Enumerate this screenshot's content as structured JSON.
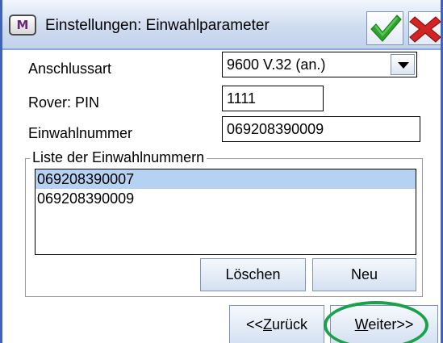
{
  "window": {
    "app_icon_letter": "M",
    "title": "Einstellungen: Einwahlparameter",
    "ok_icon": "checkmark-icon",
    "cancel_icon": "close-icon",
    "colors": {
      "title_gradient_top": "#f3f7fd",
      "title_gradient_bottom": "#c2d2ec",
      "frame_border": "#3f63b6",
      "ok_green": "#2aa52a",
      "cancel_red": "#d42323",
      "selected_row": "#b6d2f2",
      "highlight_ring": "#1aa24a"
    }
  },
  "form": {
    "connection_type_label": "Anschlussart",
    "connection_type_value": "9600 V.32 (an.)",
    "rover_pin_label": "Rover: PIN",
    "rover_pin_value": "1111",
    "dial_number_label": "Einwahlnummer",
    "dial_number_value": "069208390009"
  },
  "dial_list": {
    "group_title": "Liste der Einwahlnummern",
    "items": [
      "069208390007",
      "069208390009"
    ],
    "selected_index": 0,
    "delete_label": "Löschen",
    "new_label": "Neu"
  },
  "navigation": {
    "back_prefix": "<<",
    "back_accel": "Z",
    "back_rest": "urück",
    "next_accel": "W",
    "next_rest": "eiter>>"
  }
}
